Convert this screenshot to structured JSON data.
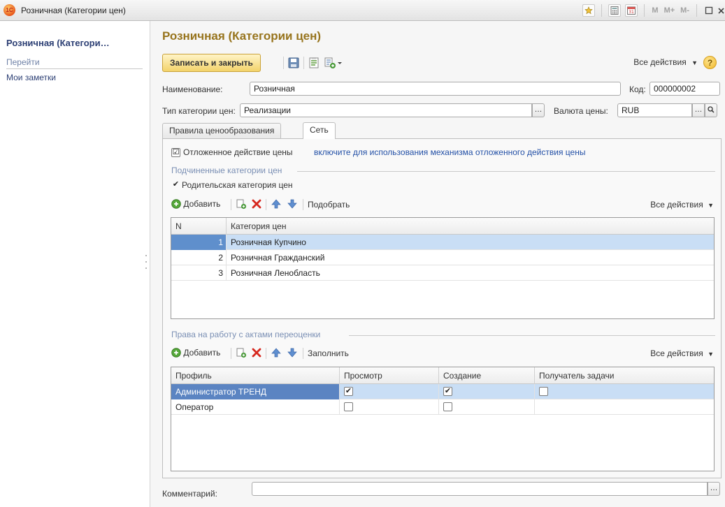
{
  "window": {
    "title": "Розничная (Категории цен)",
    "tools": [
      "M",
      "M+",
      "M-"
    ]
  },
  "sidebar": {
    "title": "Розничная (Категори…",
    "section": "Перейти",
    "link": "Мои заметки"
  },
  "form": {
    "title": "Розничная (Категории цен)",
    "save_close": "Записать и закрыть",
    "all_actions": "Все действия",
    "help": "?"
  },
  "fields": {
    "name_label": "Наименование:",
    "name_value": "Розничная",
    "code_label": "Код:",
    "code_value": "000000002",
    "type_label": "Тип категории цен:",
    "type_value": "Реализации",
    "currency_label": "Валюта цены:",
    "currency_value": "RUB",
    "comment_label": "Комментарий:",
    "comment_value": ""
  },
  "tabs": [
    {
      "label": "Правила ценообразования"
    },
    {
      "label": "Сеть"
    }
  ],
  "network": {
    "deferred_label": "Отложенное действие цены",
    "deferred_link": "включите для использования механизма отложенного действия цены",
    "sub_group": "Подчиненные категории цен",
    "parent_label": "Родительская категория цен",
    "add": "Добавить",
    "pick": "Подобрать",
    "all_actions": "Все действия",
    "columns": [
      "N",
      "Категория цен"
    ],
    "rows": [
      {
        "n": "1",
        "name": "Розничная Купчино"
      },
      {
        "n": "2",
        "name": "Розничная Гражданский"
      },
      {
        "n": "3",
        "name": "Розничная Ленобласть"
      }
    ]
  },
  "rights": {
    "group": "Права на работу с актами переоценки",
    "add": "Добавить",
    "fill": "Заполнить",
    "all_actions": "Все действия",
    "columns": [
      "Профиль",
      "Просмотр",
      "Создание",
      "Получатель задачи"
    ],
    "rows": [
      {
        "profile": "Администратор ТРЕНД",
        "view": true,
        "create": true,
        "recipient": false
      },
      {
        "profile": "Оператор",
        "view": false,
        "create": false,
        "recipient": null
      }
    ]
  },
  "colors": {
    "accent": "#97741d",
    "link": "#2350a6",
    "selection": "#c9def5"
  }
}
